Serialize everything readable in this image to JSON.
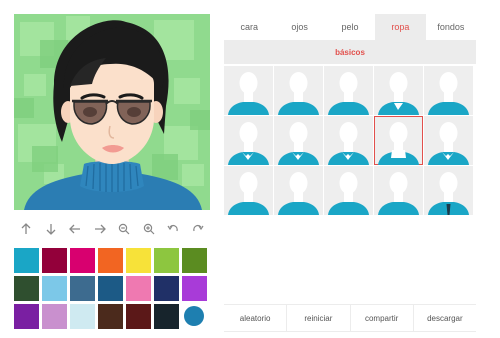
{
  "tabs": [
    {
      "label": "cara"
    },
    {
      "label": "ojos"
    },
    {
      "label": "pelo"
    },
    {
      "label": "ropa",
      "active": true
    },
    {
      "label": "fondos"
    }
  ],
  "subtab": {
    "label": "básicos"
  },
  "toolbar": [
    {
      "icon": "arrow-up-icon"
    },
    {
      "icon": "arrow-down-icon"
    },
    {
      "icon": "arrow-left-icon"
    },
    {
      "icon": "arrow-right-icon"
    },
    {
      "icon": "zoom-out-icon"
    },
    {
      "icon": "zoom-in-icon"
    },
    {
      "icon": "undo-icon"
    },
    {
      "icon": "redo-icon"
    }
  ],
  "palette": [
    "#1aa6c6",
    "#93003a",
    "#d8006f",
    "#f26522",
    "#f7e239",
    "#8dc63f",
    "#5b8c21",
    "#2f4f2f",
    "#7cc8e8",
    "#3d6b8f",
    "#1c5a86",
    "#ef79b1",
    "#203067",
    "#a83bd8",
    "#7a1fa2",
    "#c990ce",
    "#cfeaf1",
    "#4b2a1c",
    "#5b1818",
    "#17242c",
    "#1e7fb0"
  ],
  "selected_color": "#1e7fb0",
  "clothes": {
    "selected_index": 8,
    "items": [
      {
        "style": "tee-wide",
        "color": "#1aa6c6"
      },
      {
        "style": "tee",
        "color": "#1aa6c6"
      },
      {
        "style": "tee-narrow",
        "color": "#1aa6c6"
      },
      {
        "style": "tee-v",
        "color": "#1aa6c6"
      },
      {
        "style": "tee-round",
        "color": "#1aa6c6"
      },
      {
        "style": "collar-shirt",
        "color": "#1aa6c6"
      },
      {
        "style": "polo",
        "color": "#1aa6c6"
      },
      {
        "style": "collar-open",
        "color": "#1aa6c6"
      },
      {
        "style": "turtleneck",
        "color": "#1aa6c6"
      },
      {
        "style": "collar-small",
        "color": "#1aa6c6"
      },
      {
        "style": "hoodie",
        "color": "#1aa6c6"
      },
      {
        "style": "jacket",
        "color": "#1aa6c6"
      },
      {
        "style": "scoop",
        "color": "#1aa6c6"
      },
      {
        "style": "crew",
        "color": "#1aa6c6"
      },
      {
        "style": "suit-tie",
        "color": "#1aa6c6"
      }
    ]
  },
  "actions": [
    {
      "label": "aleatorio"
    },
    {
      "label": "reiniciar"
    },
    {
      "label": "compartir"
    },
    {
      "label": "descargar"
    }
  ],
  "colors": {
    "accent": "#e2504c",
    "background_green": "#8fd98f",
    "sweater": "#2b7db3",
    "skin": "#fbe0cb",
    "hair": "#1b1b1b"
  }
}
